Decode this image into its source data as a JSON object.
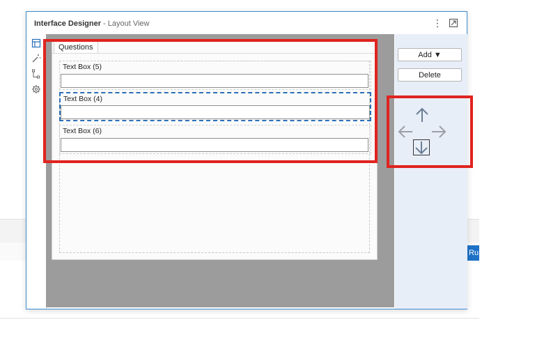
{
  "dialog": {
    "title": "Interface Designer",
    "subtitle": "- Layout View"
  },
  "sidebar": {
    "items": [
      {
        "icon": "layout-icon",
        "active": true
      },
      {
        "icon": "magic-wand-icon"
      },
      {
        "icon": "tree-icon"
      },
      {
        "icon": "gear-icon"
      }
    ]
  },
  "form": {
    "tab_label": "Questions",
    "fields": [
      {
        "label": "Text Box (5)",
        "value": ""
      },
      {
        "label": "Text Box (4)",
        "value": "",
        "selected": true
      },
      {
        "label": "Text Box (6)",
        "value": ""
      }
    ]
  },
  "actions": {
    "add_label": "Add ▼",
    "delete_label": "Delete"
  },
  "background": {
    "run_label": "Ru"
  },
  "colors": {
    "highlight": "#e0231f",
    "accent": "#2a6fb6",
    "selected_field_border": "#2a6fb6",
    "arrow_active": "#6b7f95",
    "arrow_inactive": "#9aa0a6"
  }
}
